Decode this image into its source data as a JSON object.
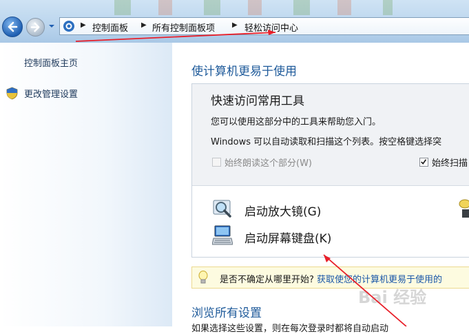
{
  "breadcrumb": [
    "控制面板",
    "所有控制面板项",
    "轻松访问中心"
  ],
  "sidebar": {
    "home_link": "控制面板主页",
    "admin_link": "更改管理设置"
  },
  "main": {
    "title": "使计算机更易于使用",
    "quick": {
      "title": "快速访问常用工具",
      "line1": "您可以使用这部分中的工具来帮助您入门。",
      "line2": "Windows 可以自动读取和扫描这个列表。按空格键选择突",
      "read_aloud_label": "始终朗读这个部分(W)",
      "read_aloud_checked": false,
      "scan_label": "始终扫描",
      "scan_checked": true,
      "tools": [
        {
          "label": "启动放大镜(G)",
          "icon": "magnifier-icon"
        },
        {
          "label": "启动屏幕键盘(K)",
          "icon": "on-screen-keyboard-icon"
        }
      ]
    },
    "tip": {
      "question": "是否不确定从哪里开始?",
      "link": "获取使您的计算机更易于使用的"
    },
    "browse_title": "浏览所有设置",
    "browse_desc": "如果选择这些设置，则在每次登录时都将自动启动"
  },
  "watermark": "Bai 经验",
  "colors": {
    "link_blue": "#1e5a9a",
    "nav_blue": "#bcd6ee",
    "annotation_red": "#e8202a"
  }
}
